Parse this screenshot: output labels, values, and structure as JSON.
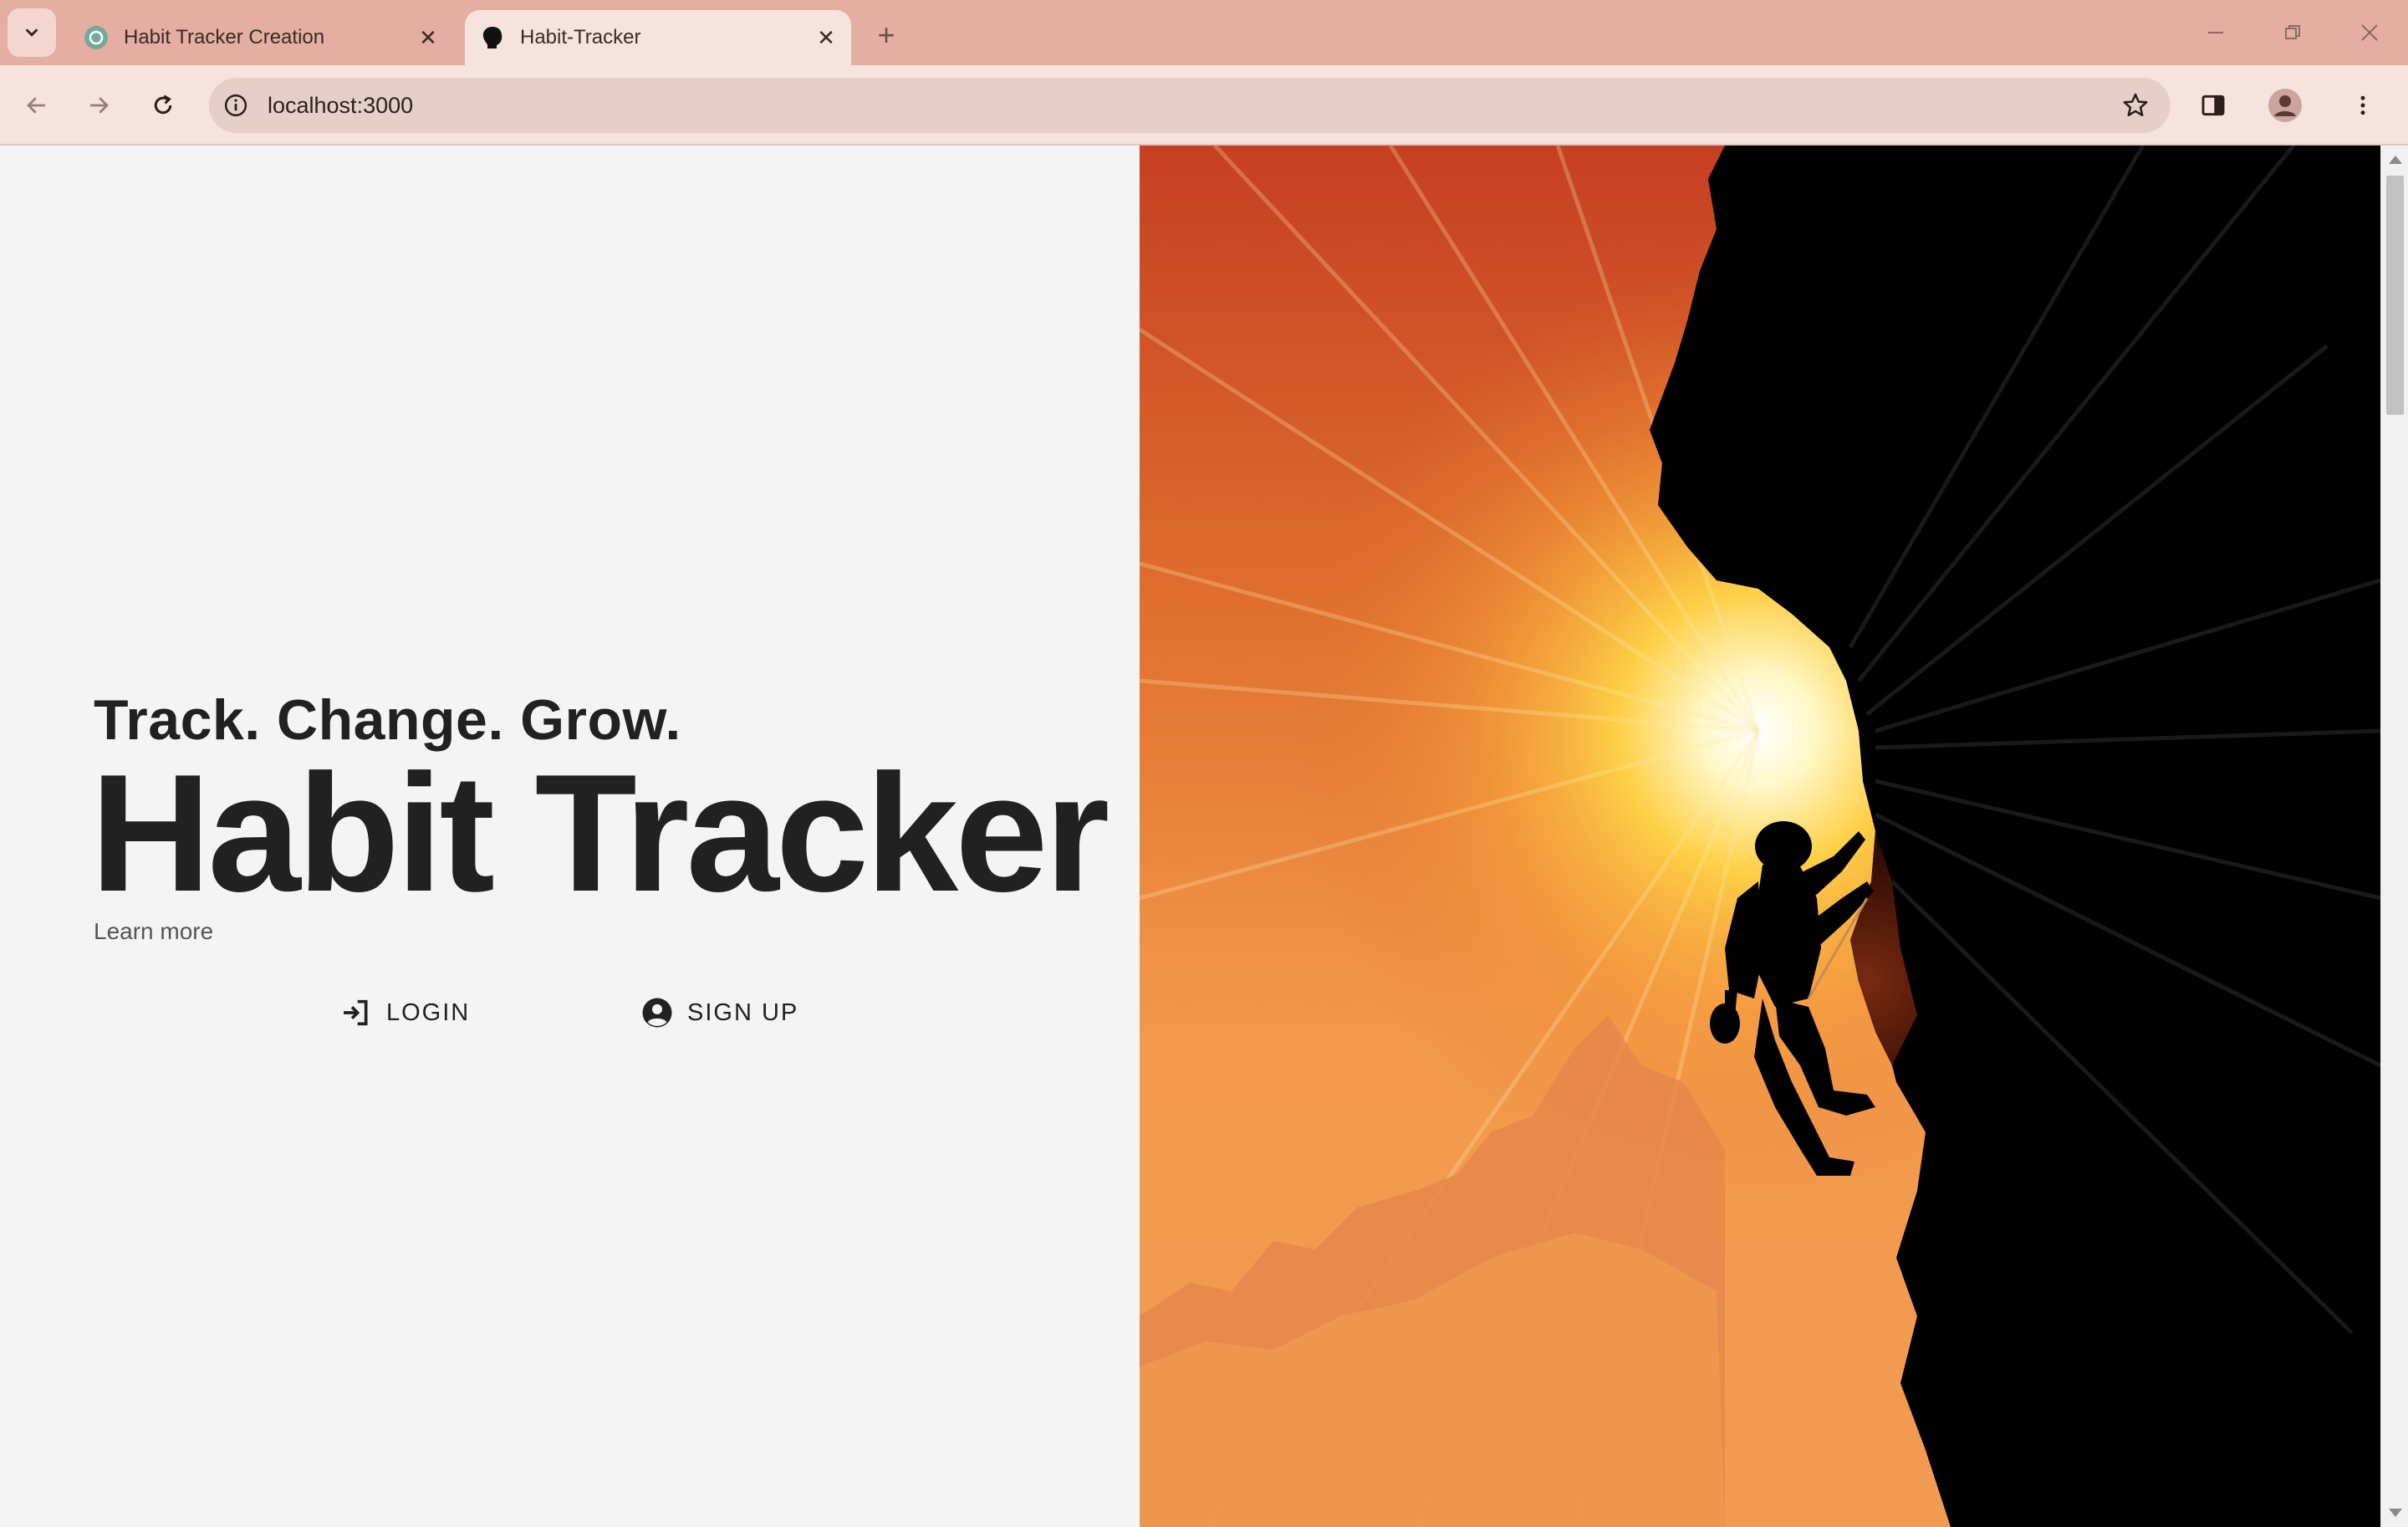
{
  "browser": {
    "tabs": [
      {
        "title": "Habit Tracker Creation",
        "favicon": "chatgpt-icon",
        "active": false
      },
      {
        "title": "Habit-Tracker",
        "favicon": "app-logo-icon",
        "active": true
      }
    ],
    "address_bar": {
      "url": "localhost:3000"
    }
  },
  "hero": {
    "tagline": "Track. Change. Grow.",
    "title": "Habit Tracker",
    "learn_more": "Learn more",
    "login_label": "LOGIN",
    "signup_label": "SIGN UP",
    "image": "climber-silhouette-at-sunset-illustration"
  },
  "colors": {
    "chrome_tabbar": "#e4aea2",
    "chrome_toolbar": "#f7e3de",
    "page_background": "#f4f4f4",
    "text_primary": "#212121",
    "sky_top": "#c63f22",
    "sun_glow": "#fff4b0",
    "cliff": "#000000"
  }
}
